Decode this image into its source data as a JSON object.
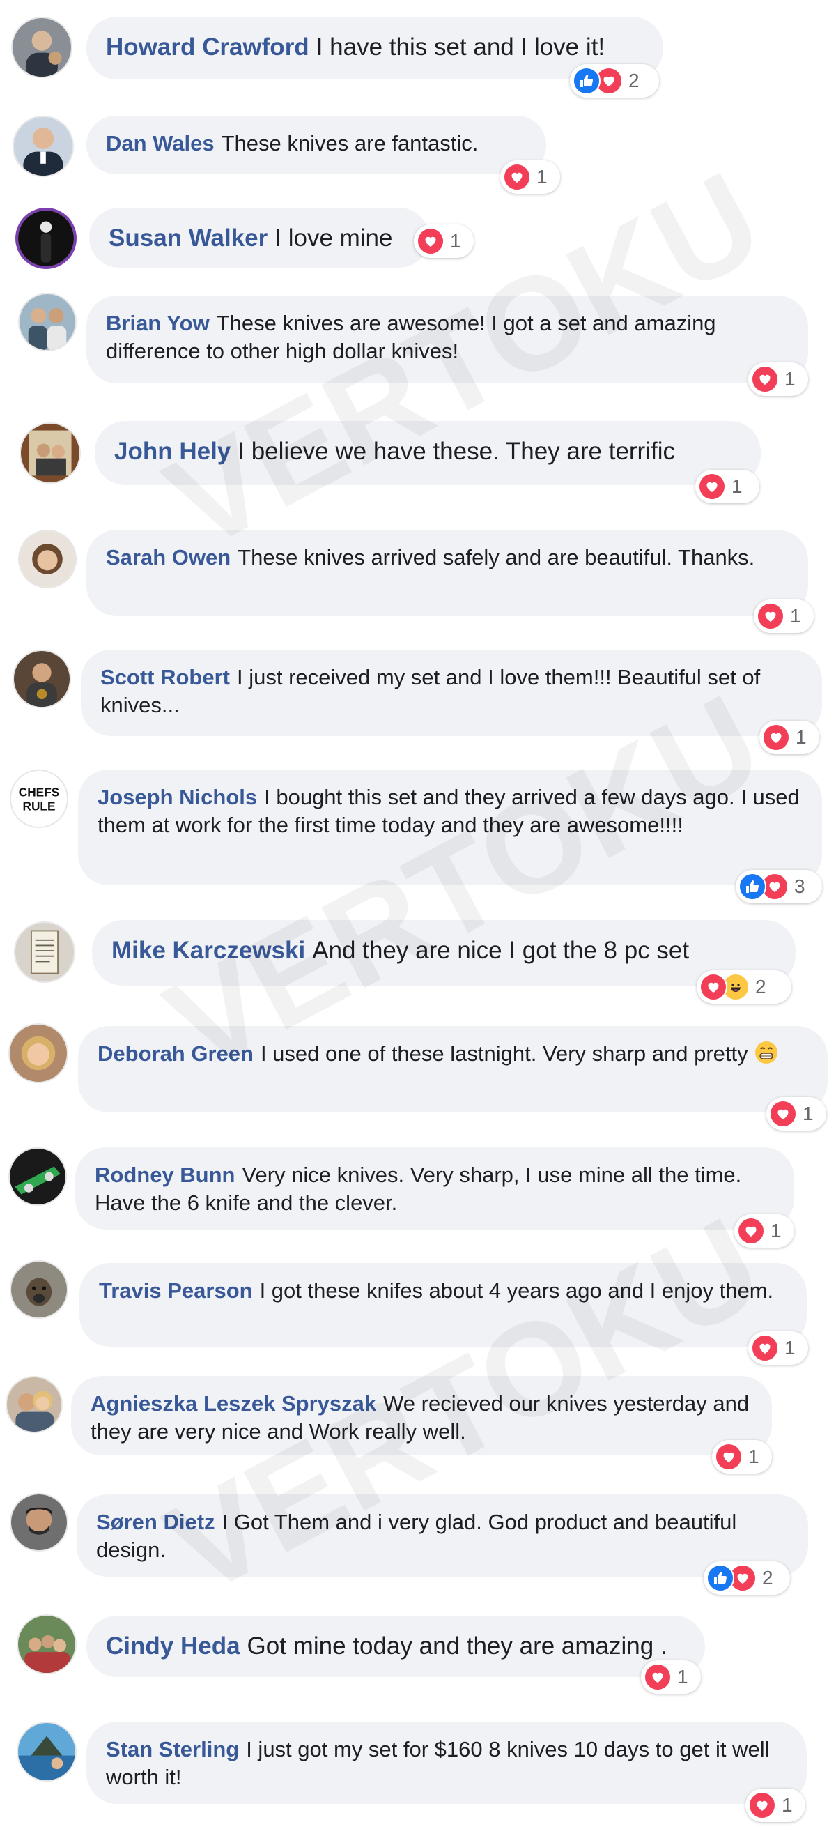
{
  "colors": {
    "name": "#385898",
    "bubble": "#f0f2f5",
    "love": "#f33e58",
    "like": "#1877f2",
    "haha": "#fcc844",
    "count": "#65676b"
  },
  "watermark_text": "VERTOKU",
  "comments": [
    {
      "name": "Howard Crawford",
      "text": "I have this set and I love it!",
      "reactions": [
        "like",
        "love"
      ],
      "count": "2"
    },
    {
      "name": "Dan Wales",
      "text": "These knives are fantastic.",
      "reactions": [
        "love"
      ],
      "count": "1"
    },
    {
      "name": "Susan Walker",
      "text": "I love mine",
      "reactions": [
        "love"
      ],
      "count": "1"
    },
    {
      "name": "Brian Yow",
      "text": "These knives are awesome! I got a set and amazing difference to other high dollar knives!",
      "reactions": [
        "love"
      ],
      "count": "1"
    },
    {
      "name": "John Hely",
      "text": "I believe we have these. They are terrific",
      "reactions": [
        "love"
      ],
      "count": "1"
    },
    {
      "name": "Sarah Owen",
      "text": "These knives arrived safely and are beautiful. Thanks.",
      "reactions": [
        "love"
      ],
      "count": "1"
    },
    {
      "name": "Scott Robert",
      "text": "I just received my set and I love them!!! Beautiful set of knives...",
      "reactions": [
        "love"
      ],
      "count": "1"
    },
    {
      "name": "Joseph Nichols",
      "text": "I bought this set and they arrived a few days ago. I used them at work for the first time today and they are awesome!!!!",
      "reactions": [
        "like",
        "love"
      ],
      "count": "3",
      "avatar_text": [
        "CHEFS",
        "RULE"
      ]
    },
    {
      "name": "Mike Karczewski",
      "text": "And they are nice I got the 8 pc set",
      "reactions": [
        "love",
        "haha"
      ],
      "count": "2"
    },
    {
      "name": "Deborah Green",
      "text": "I used one of these lastnight. Very sharp and pretty",
      "emoji": "grin-icon",
      "reactions": [
        "love"
      ],
      "count": "1"
    },
    {
      "name": "Rodney Bunn",
      "text": "Very nice knives. Very sharp, I use mine all the time. Have the 6 knife and the clever.",
      "reactions": [
        "love"
      ],
      "count": "1"
    },
    {
      "name": "Travis Pearson",
      "text": "I got these knifes about 4 years ago and I enjoy them.",
      "reactions": [
        "love"
      ],
      "count": "1"
    },
    {
      "name": "Agnieszka Leszek Spryszak",
      "text": "We recieved our knives yesterday and they are very nice and Work really well.",
      "reactions": [
        "love"
      ],
      "count": "1"
    },
    {
      "name": "Søren Dietz",
      "text": "I Got Them and i very glad. God product and beautiful design.",
      "reactions": [
        "like",
        "love"
      ],
      "count": "2"
    },
    {
      "name": "Cindy Heda",
      "text": "Got mine today and they are amazing .",
      "reactions": [
        "love"
      ],
      "count": "1"
    },
    {
      "name": "Stan Sterling",
      "text": "I just got my set for $160 8 knives 10 days to get it well worth it!",
      "reactions": [
        "love"
      ],
      "count": "1"
    }
  ]
}
